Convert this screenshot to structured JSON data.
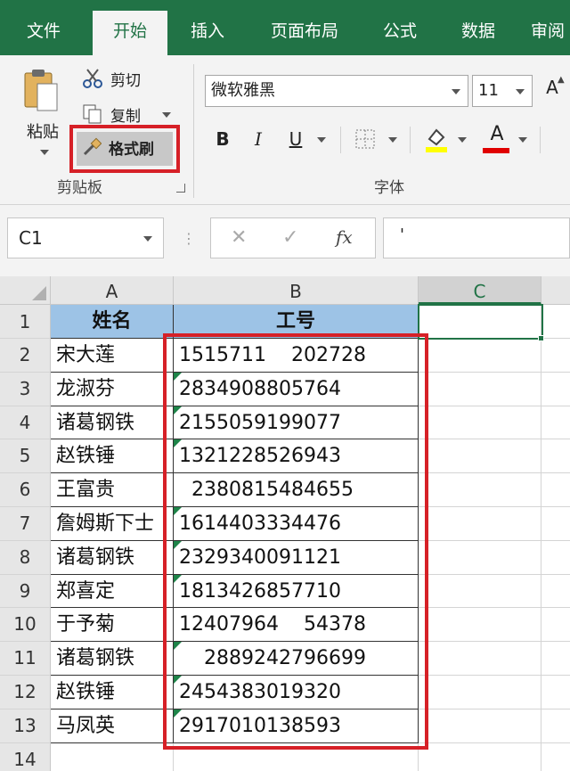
{
  "ribbon": {
    "tabs": [
      "文件",
      "开始",
      "插入",
      "页面布局",
      "公式",
      "数据",
      "审阅"
    ],
    "active_tab": "开始",
    "clipboard": {
      "paste": "粘贴",
      "cut": "剪切",
      "copy": "复制",
      "format_painter": "格式刷",
      "group_label": "剪贴板"
    },
    "font": {
      "name": "微软雅黑",
      "size": "11",
      "grow": "A",
      "bold": "B",
      "italic": "I",
      "underline": "U",
      "font_color_letter": "A",
      "group_label": "字体",
      "fill_color": "#ffff00",
      "font_color": "#e00000"
    }
  },
  "formula_bar": {
    "name_box": "C1",
    "cancel": "✕",
    "enter": "✓",
    "fx": "fx",
    "content": "'"
  },
  "sheet": {
    "columns": [
      "A",
      "B",
      "C"
    ],
    "selected_column": "C",
    "rows": [
      {
        "num": "1",
        "a": "姓名",
        "b": "工号"
      },
      {
        "num": "2",
        "a": "宋大莲",
        "b": "1515711    202728",
        "tri": false
      },
      {
        "num": "3",
        "a": "龙淑芬",
        "b": "2834908805764",
        "tri": true
      },
      {
        "num": "4",
        "a": "诸葛钢铁",
        "b": "2155059199077",
        "tri": true
      },
      {
        "num": "5",
        "a": "赵铁锤",
        "b": "1321228526943",
        "tri": true
      },
      {
        "num": "6",
        "a": "王富贵",
        "b": "  2380815484655",
        "tri": false
      },
      {
        "num": "7",
        "a": "詹姆斯下士",
        "b": "1614403334476",
        "tri": true
      },
      {
        "num": "8",
        "a": "诸葛钢铁",
        "b": "2329340091121",
        "tri": true
      },
      {
        "num": "9",
        "a": "郑喜定",
        "b": "1813426857710",
        "tri": true
      },
      {
        "num": "10",
        "a": "于予菊",
        "b": "12407964    54378",
        "tri": false
      },
      {
        "num": "11",
        "a": "诸葛钢铁",
        "b": "    2889242796699",
        "tri": true
      },
      {
        "num": "12",
        "a": "赵铁锤",
        "b": "2454383019320",
        "tri": true
      },
      {
        "num": "13",
        "a": "马凤英",
        "b": "2917010138593",
        "tri": true
      },
      {
        "num": "14",
        "a": "",
        "b": ""
      }
    ]
  }
}
